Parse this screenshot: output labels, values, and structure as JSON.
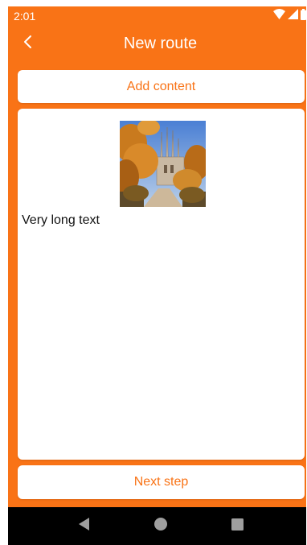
{
  "status_bar": {
    "time": "2:01",
    "icons": [
      "wifi-icon",
      "signal-icon",
      "battery-icon"
    ]
  },
  "app_bar": {
    "title": "New route",
    "back_icon": "chevron-left-icon"
  },
  "add_content_button": {
    "label": "Add content"
  },
  "content": {
    "image_description": "Sagrada Familia cathedral with autumn trees",
    "text": "Very long text"
  },
  "next_step_button": {
    "label": "Next step"
  },
  "nav_bar": {
    "items": [
      "back-nav-icon",
      "home-nav-icon",
      "recents-nav-icon"
    ]
  },
  "colors": {
    "accent": "#f97316",
    "surface": "#ffffff",
    "nav_background": "#000000"
  }
}
